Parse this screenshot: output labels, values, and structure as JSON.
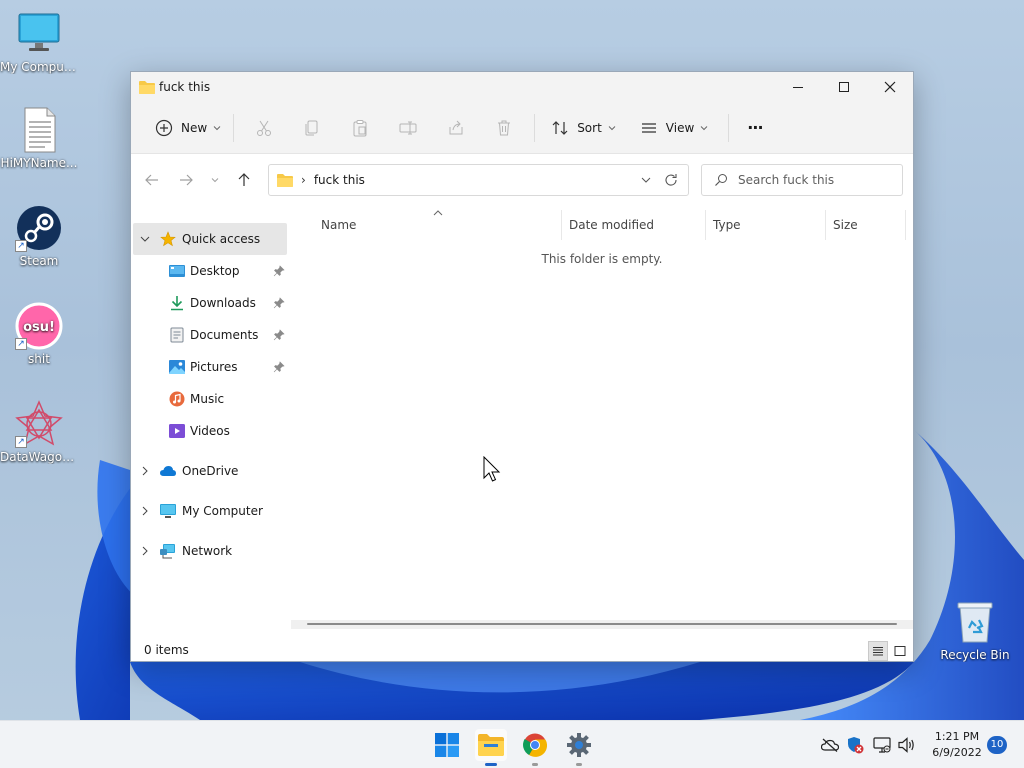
{
  "desktop": {
    "icons": [
      {
        "label": "My Computer",
        "icon": "monitor-icon"
      },
      {
        "label": "HiMYName...",
        "icon": "text-file-icon"
      },
      {
        "label": "Steam",
        "icon": "steam-icon"
      },
      {
        "label": "shit",
        "icon": "osu-icon",
        "glyph": "osu!"
      },
      {
        "label": "DataWagon...",
        "icon": "datawagon-icon"
      },
      {
        "label": "Recycle Bin",
        "icon": "recycle-bin-icon"
      }
    ]
  },
  "window": {
    "title": "fuck this",
    "controls": [
      "minimize-icon",
      "maximize-icon",
      "close-icon"
    ]
  },
  "toolbar": {
    "new_label": "New",
    "sort_label": "Sort",
    "view_label": "View",
    "more_label": "···"
  },
  "navigation": {
    "address_path": "fuck this",
    "address_separator": "›",
    "search_placeholder": "Search fuck this"
  },
  "sidebar": {
    "quick_access": "Quick access",
    "quick_items": [
      {
        "label": "Desktop",
        "pinned": true
      },
      {
        "label": "Downloads",
        "pinned": true
      },
      {
        "label": "Documents",
        "pinned": true
      },
      {
        "label": "Pictures",
        "pinned": true
      },
      {
        "label": "Music",
        "pinned": false
      },
      {
        "label": "Videos",
        "pinned": false
      }
    ],
    "roots": [
      {
        "label": "OneDrive"
      },
      {
        "label": "My Computer"
      },
      {
        "label": "Network"
      }
    ]
  },
  "content": {
    "columns": [
      "Name",
      "Date modified",
      "Type",
      "Size"
    ],
    "empty_message": "This folder is empty."
  },
  "status": {
    "item_count": "0 items"
  },
  "taskbar": {
    "time": "1:21 PM",
    "date": "6/9/2022",
    "notification_count": "10"
  },
  "colors": {
    "accent": "#1e63c6",
    "folder": "#f7c948",
    "window_chrome": "#f3f3f3",
    "selection": "#e6e6e6"
  }
}
